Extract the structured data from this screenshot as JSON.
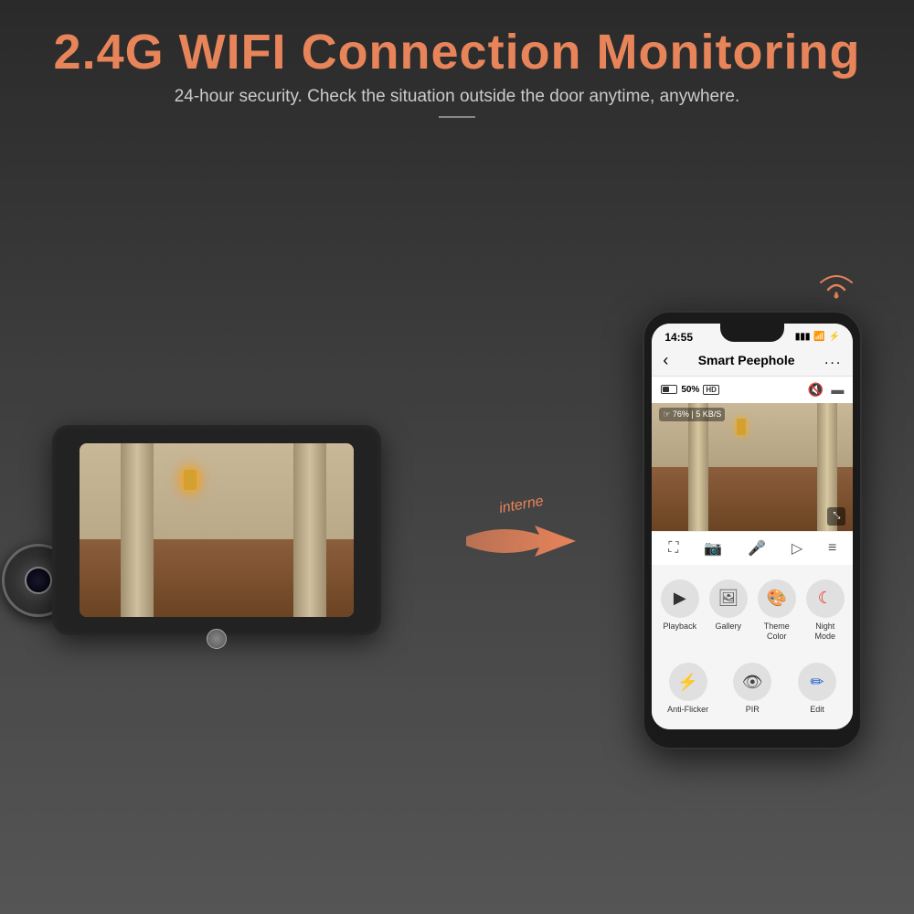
{
  "header": {
    "title": "2.4G WIFI Connection Monitoring",
    "subtitle": "24-hour security. Check the situation outside the door anytime, anywhere.",
    "divider": "—"
  },
  "arrow": {
    "label": "interne"
  },
  "phone": {
    "status_time": "14:55",
    "app_title": "Smart Peephole",
    "back_label": "‹",
    "more_label": "...",
    "battery_percent": "50%",
    "hd_label": "HD",
    "wifi_signal": "☞ 76% | 5 KB/S",
    "controls": [
      {
        "icon": "⛶",
        "label": ""
      },
      {
        "icon": "⊡",
        "label": ""
      },
      {
        "icon": "🎤",
        "label": ""
      },
      {
        "icon": "▷",
        "label": ""
      },
      {
        "icon": "≡",
        "label": ""
      }
    ],
    "app_items": [
      {
        "icon": "▶",
        "label": "Playback",
        "bg": "#eee",
        "color": "#333"
      },
      {
        "icon": "🖼",
        "label": "Gallery",
        "bg": "#eee",
        "color": "#555"
      },
      {
        "icon": "🎨",
        "label": "Theme Color",
        "bg": "#eee",
        "color": "#e07040"
      },
      {
        "icon": "☾",
        "label": "Night Mode",
        "bg": "#eee",
        "color": "#e05030"
      }
    ],
    "app_items2": [
      {
        "icon": "⚡",
        "label": "Anti-Flicker",
        "bg": "#eee",
        "color": "#444"
      },
      {
        "icon": "👁",
        "label": "PIR",
        "bg": "#eee",
        "color": "#444"
      },
      {
        "icon": "✏",
        "label": "Edit",
        "bg": "#eee",
        "color": "#2060d0"
      }
    ]
  },
  "colors": {
    "accent": "#e8845a",
    "dark_bg": "#2a2a2a",
    "phone_bg": "#1a1a1a"
  }
}
